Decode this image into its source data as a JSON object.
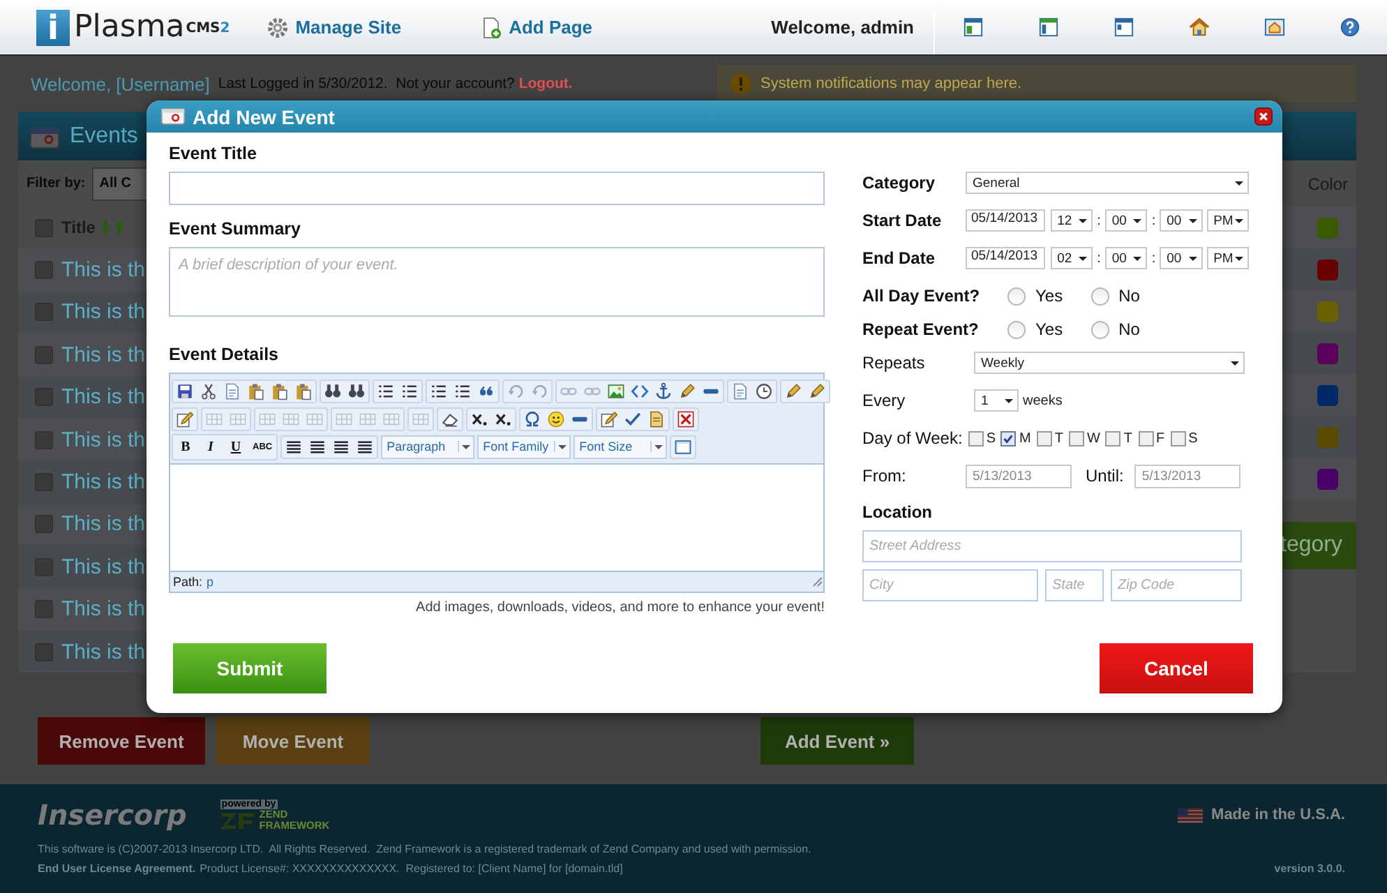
{
  "header": {
    "logo_letter": "i",
    "logo_text": "Plasma",
    "logo_badge": "CMS",
    "logo_version": "2",
    "nav": [
      {
        "kind": "gear",
        "label": "Manage Site"
      },
      {
        "kind": "page-add",
        "label": "Add Page"
      }
    ],
    "welcome": "Welcome, admin"
  },
  "welcome_bar": {
    "greeting": "Welcome, [Username]",
    "last_login": "Last Logged in 5/30/2012.  Not your account?",
    "logout": "Logout.",
    "notification": "System notifications may appear here."
  },
  "events_panel": {
    "title": "Events",
    "filter_label": "Filter by:",
    "filter_value": "All C",
    "column_title": "Title",
    "header_checked": false,
    "rows": [
      {
        "title": "This is th",
        "checked": false
      },
      {
        "title": "This is th",
        "checked": false
      },
      {
        "title": "This is th",
        "checked": false
      },
      {
        "title": "This is th",
        "checked": false
      },
      {
        "title": "This is th",
        "checked": false
      },
      {
        "title": "This is th",
        "checked": false
      },
      {
        "title": "This is th",
        "checked": false
      },
      {
        "title": "This is th",
        "checked": false
      },
      {
        "title": "This is th",
        "checked": false
      },
      {
        "title": "This is th",
        "checked": false
      }
    ],
    "color_column": "Color",
    "categories": [
      {
        "color": "#3a5a00"
      },
      {
        "color": "#6a0000"
      },
      {
        "color": "#6a6000"
      },
      {
        "color": "#5a005a"
      },
      {
        "color": "#002a66"
      },
      {
        "color": "#5a4a00"
      },
      {
        "color": "#4a006a"
      }
    ],
    "add_category": "tegory"
  },
  "actions": [
    {
      "kind": "danger",
      "label": "Remove Event"
    },
    {
      "kind": "warning",
      "label": "Move Event"
    },
    {
      "kind": "success",
      "label": "Add Event »"
    }
  ],
  "modal": {
    "title": "Add New Event",
    "event_title": {
      "label": "Event Title"
    },
    "summary": {
      "label": "Event Summary",
      "placeholder": "A brief description of your event."
    },
    "details": {
      "label": "Event Details",
      "format_buttons": [
        "B",
        "I",
        "U",
        "ABC"
      ],
      "paragraph": "Paragraph",
      "font_family": "Font Family",
      "font_size": "Font Size",
      "path_label": "Path:",
      "path_value": "p",
      "hint": "Add images, downloads, videos, and more to enhance your event!"
    },
    "category": {
      "label": "Category",
      "value": "General"
    },
    "start": {
      "label": "Start Date",
      "date": "05/14/2013",
      "hour": "12",
      "minute": "00",
      "second": "00",
      "ampm": "PM",
      "separators": [
        ":",
        ":"
      ]
    },
    "end": {
      "label": "End Date",
      "date": "05/14/2013",
      "hour": "02",
      "minute": "00",
      "second": "00",
      "ampm": "PM",
      "separators": [
        ":",
        ":"
      ]
    },
    "all_day": {
      "label": "All Day Event?",
      "options": [
        {
          "label": "Yes",
          "selected": false
        },
        {
          "label": "No",
          "selected": false
        }
      ]
    },
    "repeat": {
      "label": "Repeat Event?",
      "options": [
        {
          "label": "Yes",
          "selected": false
        },
        {
          "label": "No",
          "selected": false
        }
      ]
    },
    "repeats": {
      "label": "Repeats",
      "value": "Weekly"
    },
    "every": {
      "label": "Every",
      "value": "1",
      "unit": "weeks"
    },
    "days": {
      "label": "Day of Week:",
      "items": [
        {
          "label": "S",
          "checked": false
        },
        {
          "label": "M",
          "checked": true
        },
        {
          "label": "T",
          "checked": false
        },
        {
          "label": "W",
          "checked": false
        },
        {
          "label": "T",
          "checked": false
        },
        {
          "label": "F",
          "checked": false
        },
        {
          "label": "S",
          "checked": false
        }
      ]
    },
    "from": {
      "label": "From:",
      "value": "5/13/2013",
      "disabled": true
    },
    "until": {
      "label": "Until:",
      "value": "5/13/2013",
      "disabled": true
    },
    "location": {
      "label": "Location",
      "fields": [
        {
          "placeholder": "Street Address"
        },
        {
          "placeholder": "City"
        },
        {
          "placeholder": "State"
        },
        {
          "placeholder": "Zip Code"
        }
      ]
    },
    "submit": "Submit",
    "cancel": "Cancel"
  },
  "footer": {
    "company": "Insercorp",
    "powered_by": "powered by",
    "zend_name": "ZEND",
    "zend_framework": "FRAMEWORK",
    "copyright": "This software is (C)2007-2013 Insercorp LTD.  All Rights Reserved.  Zend Framework is a registered trademark of Zend Company and used with permission.",
    "eula": "End User License Agreement.",
    "license": "Product License#: XXXXXXXXXXXXXX.  Registered to: [Client Name] for [domain.tld]",
    "made_in": "Made in the U.S.A.",
    "version": "version 3.0.0."
  }
}
